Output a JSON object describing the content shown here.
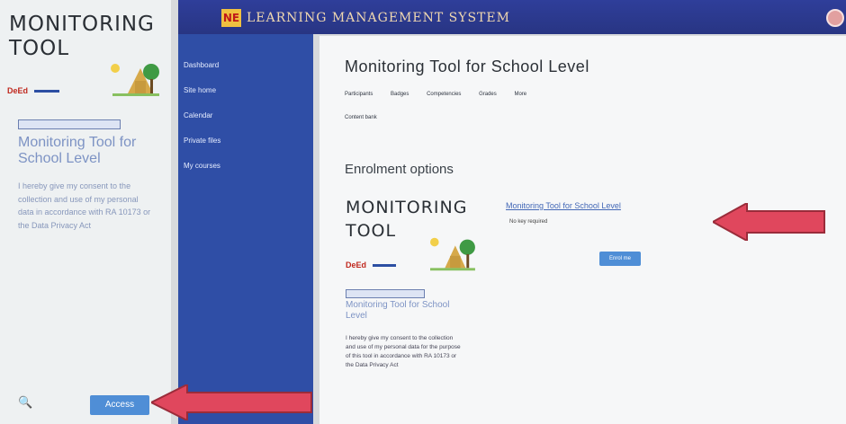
{
  "left_panel": {
    "title_line1": "MONITORING",
    "title_line2": "TOOL",
    "logo_text": "DeEd",
    "course_link": "Monitoring Tool for School Level",
    "description": "I hereby give my consent to the collection and use of my personal data in accordance with RA 10173 or the Data Privacy Act",
    "search_glyph": "🔍",
    "access_button": "Access"
  },
  "header": {
    "logo_letters": "NE",
    "system_title": "LEARNING MANAGEMENT SYSTEM"
  },
  "sidebar": {
    "items": [
      "Dashboard",
      "Site home",
      "Calendar",
      "Private files",
      "My courses"
    ]
  },
  "main": {
    "page_title": "Monitoring Tool for School Level",
    "tabs": [
      "Participants",
      "Badges",
      "Competencies",
      "Grades",
      "More"
    ],
    "tab_second_row": "Content bank",
    "enrolment_heading": "Enrolment options",
    "enrol_link": "Monitoring Tool for School Level",
    "enrol_sub": "No key required",
    "enrol_button": "Enrol me",
    "card": {
      "title_line1": "MONITORING",
      "title_line2": "TOOL",
      "logo_text": "DeEd",
      "course_link": "Monitoring Tool for School Level",
      "description": "I hereby give my consent to the collection and use of my personal data for the purpose of this tool in accordance with RA 10173 or the Data Privacy Act"
    }
  },
  "colors": {
    "accent_blue": "#4f8ed6",
    "sidebar_blue": "#2f4ea6",
    "arrow_red": "#e0475d"
  }
}
